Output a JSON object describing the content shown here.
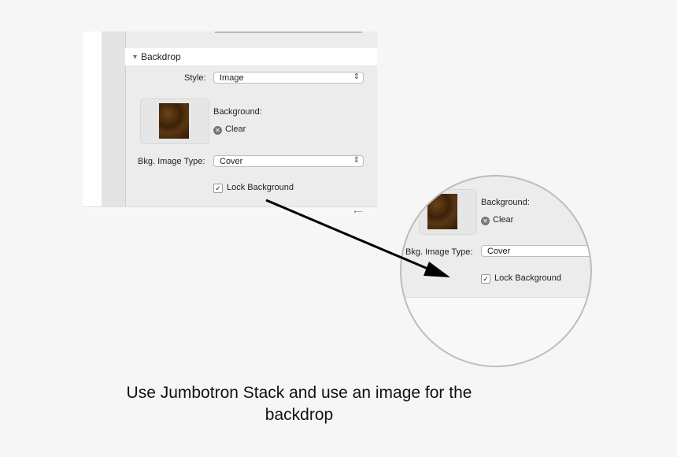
{
  "panel": {
    "section_title": "Backdrop",
    "style_label": "Style:",
    "style_value": "Image",
    "background_label": "Background:",
    "clear_label": "Clear",
    "bkg_type_label": "Bkg. Image Type:",
    "bkg_type_value": "Cover",
    "lock_label": "Lock Background",
    "lock_checked": true
  },
  "magnifier": {
    "background_label": "Background:",
    "clear_label": "Clear",
    "bkg_type_label": "Bkg. Image Type:",
    "bkg_type_value": "Cover",
    "lock_label": "Lock Background"
  },
  "icons": {
    "disclosure": "▼",
    "stepper": "⌃⌄",
    "clear": "✕",
    "check": "✓"
  },
  "caption": {
    "line1": "Use Jumbotron Stack and use an image for the",
    "line2": "backdrop"
  }
}
